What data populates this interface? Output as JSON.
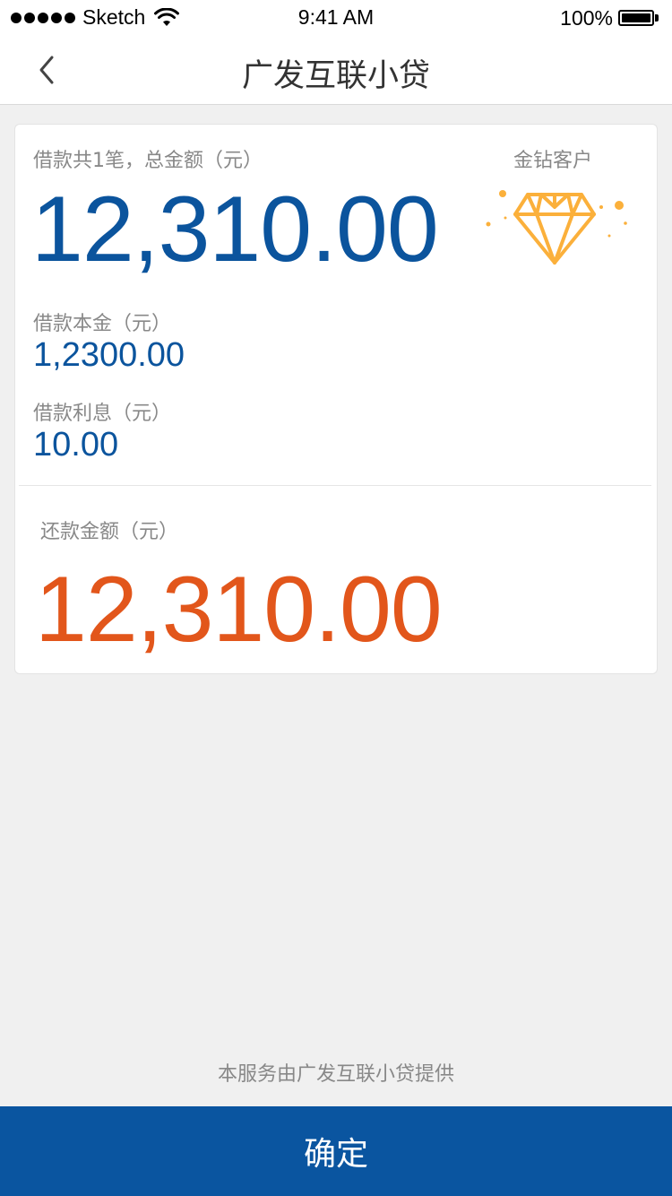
{
  "status_bar": {
    "carrier": "Sketch",
    "time": "9:41 AM",
    "battery": "100%"
  },
  "nav": {
    "title": "广发互联小贷",
    "back_icon": "chevron-left-icon"
  },
  "summary": {
    "total_label": "借款共1笔，总金额（元）",
    "total_amount": "12,310.00",
    "vip_label": "金钻客户",
    "vip_icon": "diamond-icon",
    "principal_label": "借款本金（元）",
    "principal_value": "1,2300.00",
    "interest_label": "借款利息（元）",
    "interest_value": "10.00"
  },
  "repayment": {
    "label": "还款金额（元）",
    "amount": "12,310.00"
  },
  "footer": {
    "provider_note": "本服务由广发互联小贷提供",
    "confirm_label": "确定"
  },
  "colors": {
    "brand_blue": "#0b549d",
    "accent_orange": "#e2561b",
    "diamond_gold": "#fbb03b",
    "button_blue": "#0a55a0"
  }
}
